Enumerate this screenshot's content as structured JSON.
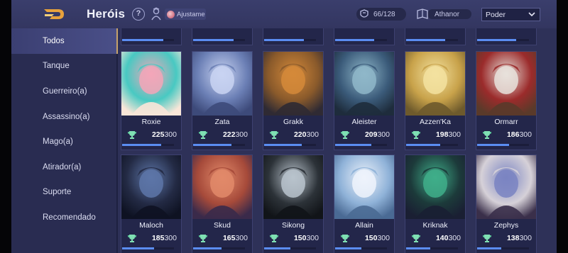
{
  "header": {
    "title": "Heróis",
    "help_label": "?",
    "account_name": "Ajustame",
    "hero_count": "66/128",
    "player_name": "Athanor",
    "sort_selected": "Poder"
  },
  "sidebar": {
    "items": [
      {
        "label": "Todos",
        "active": true
      },
      {
        "label": "Tanque"
      },
      {
        "label": "Guerreiro(a)"
      },
      {
        "label": "Assassino(a)"
      },
      {
        "label": "Mago(a)"
      },
      {
        "label": "Atirador(a)"
      },
      {
        "label": "Suporte"
      },
      {
        "label": "Recomendado"
      }
    ]
  },
  "heroes": [
    {
      "name": "Roxie",
      "power": "225",
      "max": "300",
      "progress": 0.75
    },
    {
      "name": "Zata",
      "power": "222",
      "max": "300",
      "progress": 0.74
    },
    {
      "name": "Grakk",
      "power": "220",
      "max": "300",
      "progress": 0.73
    },
    {
      "name": "Aleister",
      "power": "209",
      "max": "300",
      "progress": 0.7
    },
    {
      "name": "Azzen'Ka",
      "power": "198",
      "max": "300",
      "progress": 0.66
    },
    {
      "name": "Ormarr",
      "power": "186",
      "max": "300",
      "progress": 0.62
    },
    {
      "name": "Maloch",
      "power": "185",
      "max": "300",
      "progress": 0.62
    },
    {
      "name": "Skud",
      "power": "165",
      "max": "300",
      "progress": 0.55
    },
    {
      "name": "Sikong",
      "power": "150",
      "max": "300",
      "progress": 0.5
    },
    {
      "name": "Allain",
      "power": "150",
      "max": "300",
      "progress": 0.5
    },
    {
      "name": "Kriknak",
      "power": "140",
      "max": "300",
      "progress": 0.47
    },
    {
      "name": "Zephys",
      "power": "138",
      "max": "300",
      "progress": 0.46
    }
  ],
  "colors": {
    "background": "#2c2f56",
    "sidebar": "#292c51",
    "card": "#23264a",
    "progress": "#5b8df2",
    "accent": "#c7a36a",
    "trophy": "#7fe0b3"
  },
  "icons": {
    "back": "back-arrow-icon",
    "help": "question-icon",
    "ranking": "ranking-icon",
    "count": "hero-helmet-icon",
    "player": "book-icon",
    "dropdown": "chevron-down-icon",
    "stat": "trophy-icon"
  }
}
